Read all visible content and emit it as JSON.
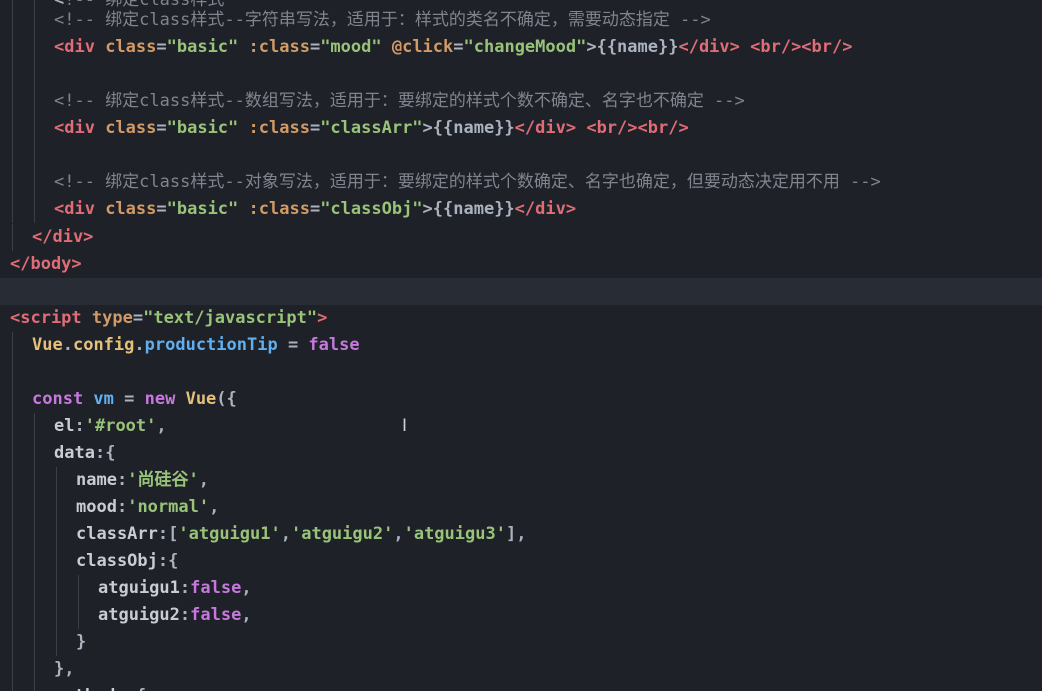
{
  "editor": {
    "lines": [
      {
        "id": "l0",
        "tokens": [
          {
            "t": "<",
            "c": "punc"
          },
          {
            "t": "!--",
            "c": "comment"
          },
          {
            "t": " 绑定class样式",
            "c": "comment"
          }
        ]
      },
      {
        "id": "l1",
        "tokens": [
          {
            "t": "<!-- 绑定class样式--字符串写法，适用于：样式的类名不确定，需要动态指定 -->",
            "c": "comment"
          }
        ]
      },
      {
        "id": "l2",
        "tokens": [
          {
            "t": "<div",
            "c": "tag"
          },
          {
            "t": " class",
            "c": "attr"
          },
          {
            "t": "=",
            "c": "punc"
          },
          {
            "t": "\"basic\"",
            "c": "str"
          },
          {
            "t": " :class",
            "c": "attr"
          },
          {
            "t": "=",
            "c": "punc"
          },
          {
            "t": "\"mood\"",
            "c": "str"
          },
          {
            "t": " @click",
            "c": "attr"
          },
          {
            "t": "=",
            "c": "punc"
          },
          {
            "t": "\"changeMood\"",
            "c": "str"
          },
          {
            "t": ">{{name}}",
            "c": "punc"
          },
          {
            "t": "</div>",
            "c": "tag"
          },
          {
            "t": " <br/><br/>",
            "c": "tag"
          }
        ]
      },
      {
        "id": "l3",
        "tokens": []
      },
      {
        "id": "l4",
        "tokens": [
          {
            "t": "<!-- 绑定class样式--数组写法，适用于：要绑定的样式个数不确定、名字也不确定 -->",
            "c": "comment"
          }
        ]
      },
      {
        "id": "l5",
        "tokens": [
          {
            "t": "<div",
            "c": "tag"
          },
          {
            "t": " class",
            "c": "attr"
          },
          {
            "t": "=",
            "c": "punc"
          },
          {
            "t": "\"basic\"",
            "c": "str"
          },
          {
            "t": " :class",
            "c": "attr"
          },
          {
            "t": "=",
            "c": "punc"
          },
          {
            "t": "\"classArr\"",
            "c": "str"
          },
          {
            "t": ">{{name}}",
            "c": "punc"
          },
          {
            "t": "</div>",
            "c": "tag"
          },
          {
            "t": " <br/><br/>",
            "c": "tag"
          }
        ]
      },
      {
        "id": "l6",
        "tokens": []
      },
      {
        "id": "l7",
        "tokens": [
          {
            "t": "<!-- 绑定class样式--对象写法，适用于：要绑定的样式个数确定、名字也确定，但要动态决定用不用 -->",
            "c": "comment"
          }
        ]
      },
      {
        "id": "l8",
        "tokens": [
          {
            "t": "<div",
            "c": "tag"
          },
          {
            "t": " class",
            "c": "attr"
          },
          {
            "t": "=",
            "c": "punc"
          },
          {
            "t": "\"basic\"",
            "c": "str"
          },
          {
            "t": " :class",
            "c": "attr"
          },
          {
            "t": "=",
            "c": "punc"
          },
          {
            "t": "\"classObj\"",
            "c": "str"
          },
          {
            "t": ">{{name}}",
            "c": "punc"
          },
          {
            "t": "</div>",
            "c": "tag"
          }
        ]
      },
      {
        "id": "l9",
        "tokens": [
          {
            "t": "</div>",
            "c": "tag"
          }
        ]
      },
      {
        "id": "l10",
        "tokens": [
          {
            "t": "</body>",
            "c": "tag"
          }
        ]
      },
      {
        "id": "l11",
        "tokens": []
      },
      {
        "id": "l12",
        "tokens": [
          {
            "t": "<script",
            "c": "tag"
          },
          {
            "t": " type",
            "c": "attr"
          },
          {
            "t": "=",
            "c": "punc"
          },
          {
            "t": "\"text/javascript\"",
            "c": "str"
          },
          {
            "t": ">",
            "c": "tag"
          }
        ]
      },
      {
        "id": "l13",
        "tokens": [
          {
            "t": "Vue",
            "c": "var"
          },
          {
            "t": ".",
            "c": "punc"
          },
          {
            "t": "config",
            "c": "var"
          },
          {
            "t": ".",
            "c": "punc"
          },
          {
            "t": "productionTip",
            "c": "prop"
          },
          {
            "t": " = ",
            "c": "punc"
          },
          {
            "t": "false",
            "c": "kw"
          }
        ]
      },
      {
        "id": "l14",
        "tokens": []
      },
      {
        "id": "l15",
        "tokens": [
          {
            "t": "const",
            "c": "kw"
          },
          {
            "t": " vm",
            "c": "id"
          },
          {
            "t": " = ",
            "c": "punc"
          },
          {
            "t": "new",
            "c": "kw"
          },
          {
            "t": " Vue",
            "c": "var"
          },
          {
            "t": "({",
            "c": "punc"
          }
        ]
      },
      {
        "id": "l16",
        "tokens": [
          {
            "t": "el",
            "c": "key"
          },
          {
            "t": ":",
            "c": "punc"
          },
          {
            "t": "'#root'",
            "c": "str"
          },
          {
            "t": ",",
            "c": "punc"
          }
        ]
      },
      {
        "id": "l17",
        "tokens": [
          {
            "t": "data",
            "c": "key"
          },
          {
            "t": ":{",
            "c": "punc"
          }
        ]
      },
      {
        "id": "l18",
        "tokens": [
          {
            "t": "name",
            "c": "key"
          },
          {
            "t": ":",
            "c": "punc"
          },
          {
            "t": "'尚硅谷'",
            "c": "str"
          },
          {
            "t": ",",
            "c": "punc"
          }
        ]
      },
      {
        "id": "l19",
        "tokens": [
          {
            "t": "mood",
            "c": "key"
          },
          {
            "t": ":",
            "c": "punc"
          },
          {
            "t": "'normal'",
            "c": "str"
          },
          {
            "t": ",",
            "c": "punc"
          }
        ]
      },
      {
        "id": "l20",
        "tokens": [
          {
            "t": "classArr",
            "c": "key"
          },
          {
            "t": ":[",
            "c": "punc"
          },
          {
            "t": "'atguigu1'",
            "c": "str"
          },
          {
            "t": ",",
            "c": "punc"
          },
          {
            "t": "'atguigu2'",
            "c": "str"
          },
          {
            "t": ",",
            "c": "punc"
          },
          {
            "t": "'atguigu3'",
            "c": "str"
          },
          {
            "t": "],",
            "c": "punc"
          }
        ]
      },
      {
        "id": "l21",
        "tokens": [
          {
            "t": "classObj",
            "c": "key"
          },
          {
            "t": ":{",
            "c": "punc"
          }
        ]
      },
      {
        "id": "l22",
        "tokens": [
          {
            "t": "atguigu1",
            "c": "key"
          },
          {
            "t": ":",
            "c": "punc"
          },
          {
            "t": "false",
            "c": "kw"
          },
          {
            "t": ",",
            "c": "punc"
          }
        ]
      },
      {
        "id": "l23",
        "tokens": [
          {
            "t": "atguigu2",
            "c": "key"
          },
          {
            "t": ":",
            "c": "punc"
          },
          {
            "t": "false",
            "c": "kw"
          },
          {
            "t": ",",
            "c": "punc"
          }
        ]
      },
      {
        "id": "l24",
        "tokens": [
          {
            "t": "}",
            "c": "punc"
          }
        ]
      },
      {
        "id": "l25",
        "tokens": [
          {
            "t": "},",
            "c": "punc"
          }
        ]
      },
      {
        "id": "l26",
        "tokens": [
          {
            "t": "methods",
            "c": "key"
          },
          {
            "t": ":{",
            "c": "punc"
          }
        ]
      }
    ]
  },
  "cursor": {
    "glyph": "I"
  }
}
